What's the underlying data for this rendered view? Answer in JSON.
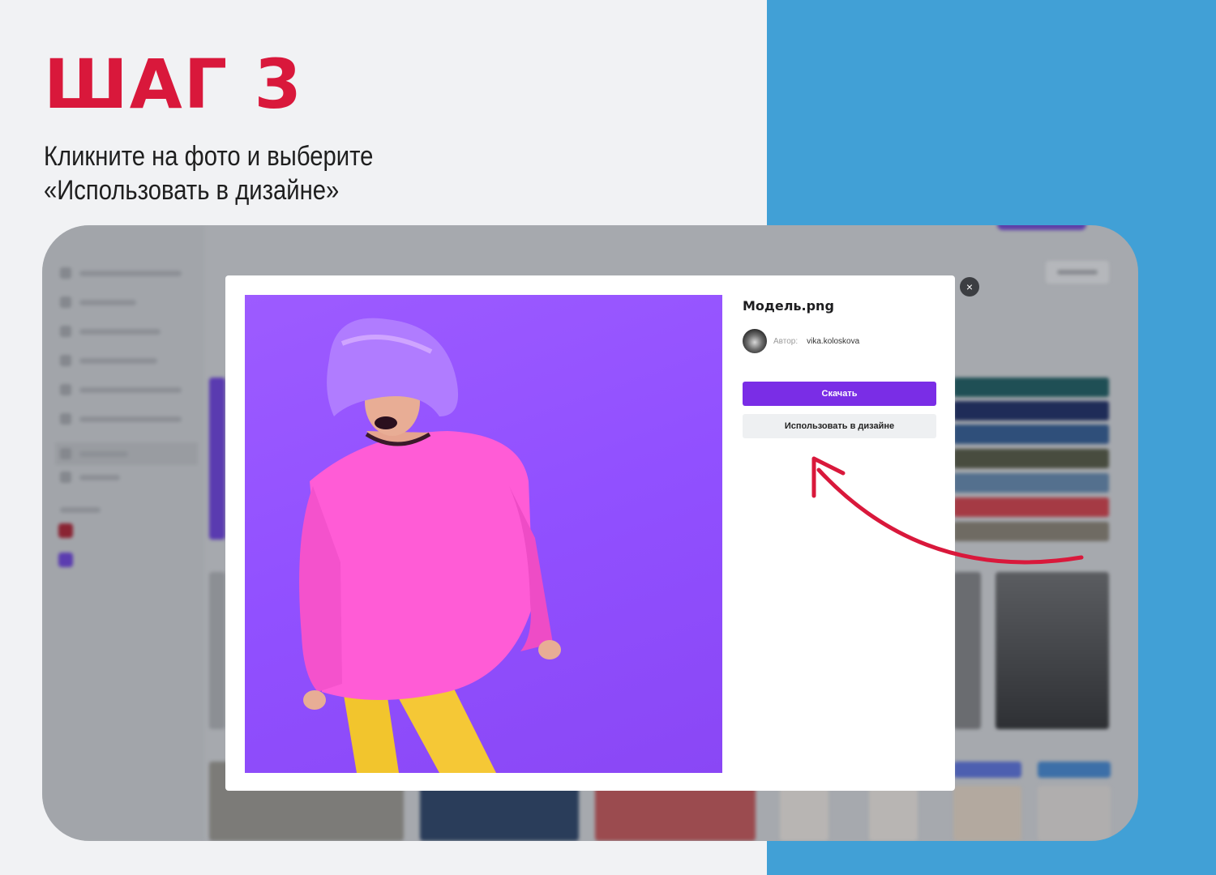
{
  "step": {
    "title": "ШАГ 3",
    "subtitle": "Кликните на фото и выберите «Использовать в дизайне»"
  },
  "modal": {
    "file_name": "Модель.png",
    "author_label": "Автор:",
    "author_name": "vika.koloskova",
    "download_label": "Скачать",
    "use_in_design_label": "Использовать в дизайне",
    "close_glyph": "×"
  },
  "colors": {
    "accent_red": "#d9183b",
    "panel_blue": "#41a0d6",
    "button_purple": "#7a2de6",
    "photo_purple": "#9150ff"
  },
  "icons": {
    "close": "close-icon",
    "arrow": "curved-arrow-icon"
  }
}
